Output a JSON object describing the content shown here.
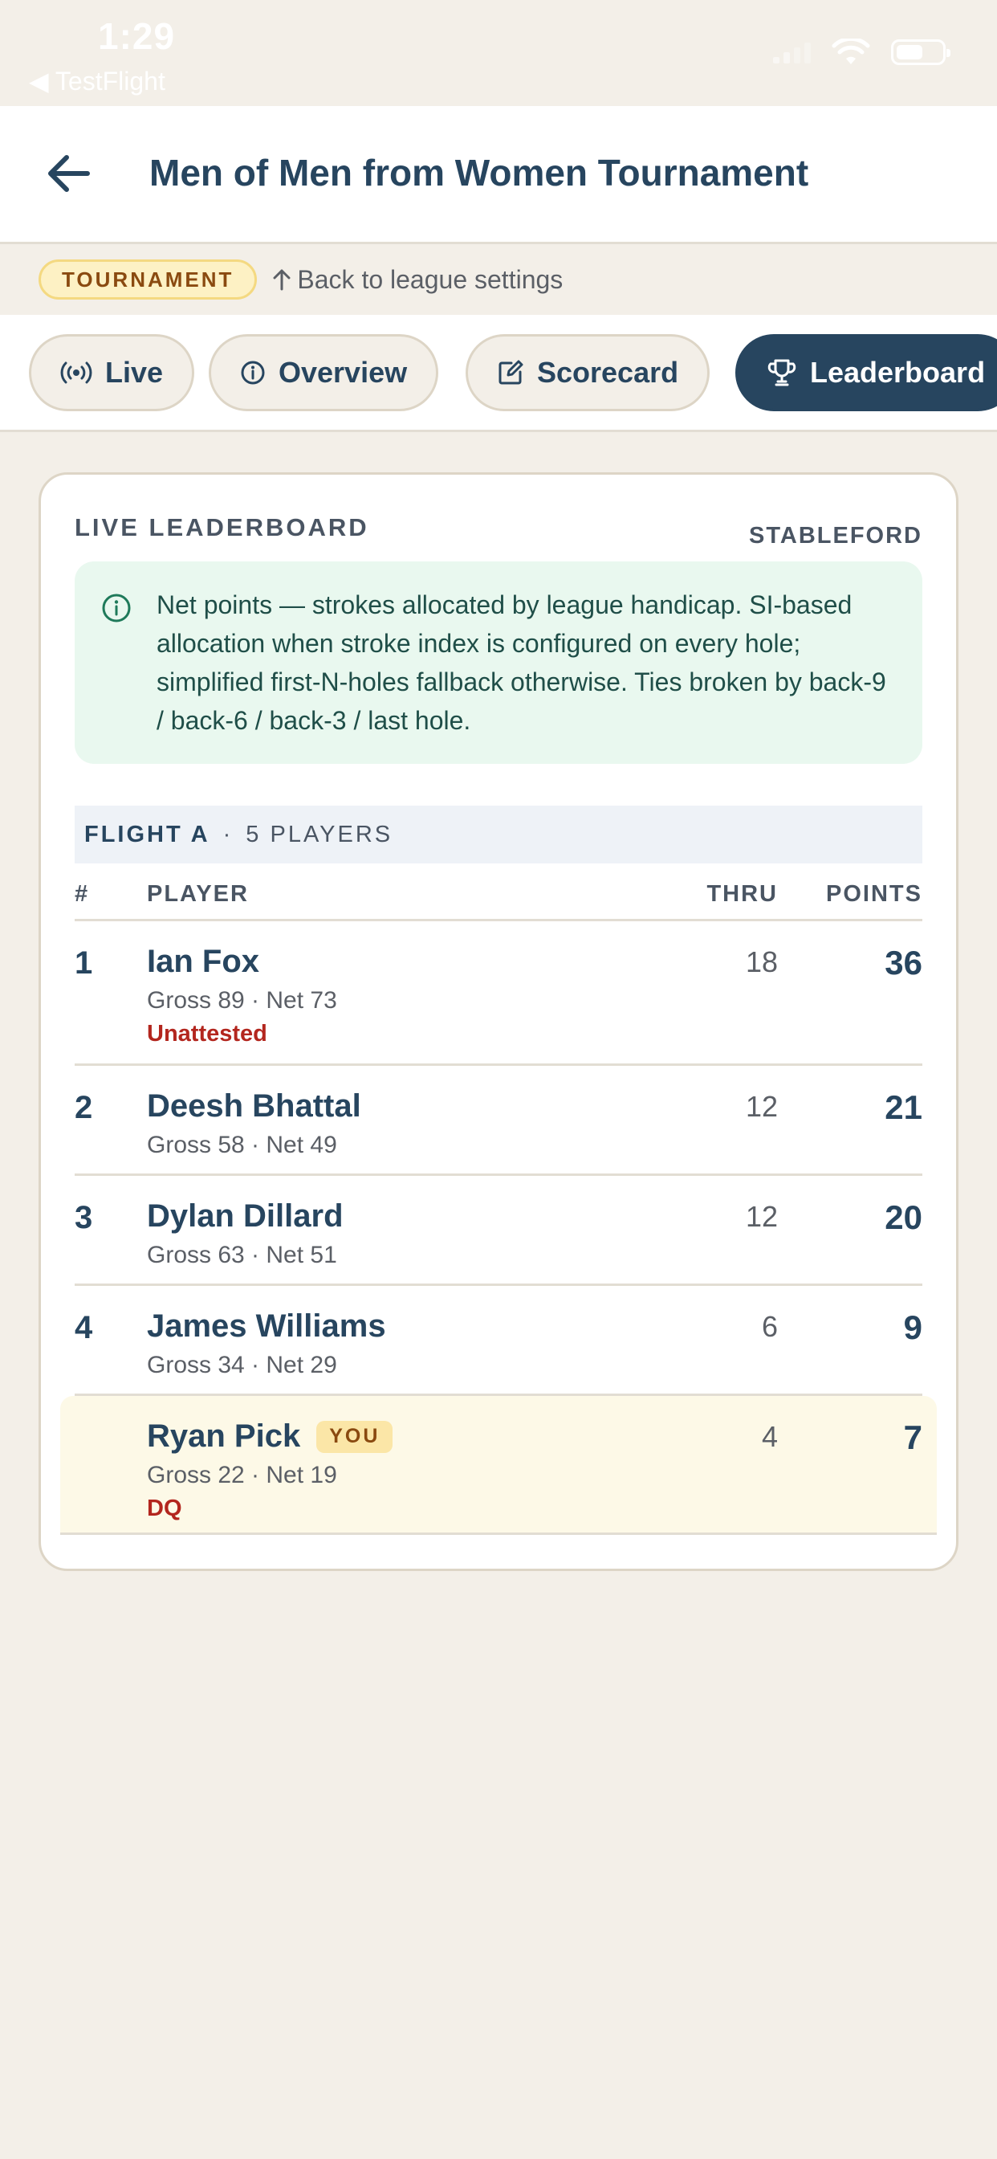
{
  "status_bar": {
    "time": "1:29",
    "back_app": "◀ TestFlight"
  },
  "header": {
    "title": "Men of Men from Women Tournament"
  },
  "subnav": {
    "badge": "TOURNAMENT",
    "back_link": "Back to league settings"
  },
  "tabs": [
    {
      "label": "Live",
      "icon": "broadcast-icon"
    },
    {
      "label": "Overview",
      "icon": "info-icon"
    },
    {
      "label": "Scorecard",
      "icon": "edit-icon"
    },
    {
      "label": "Leaderboard",
      "icon": "trophy-icon",
      "active": true
    }
  ],
  "leaderboard": {
    "title": "LIVE LEADERBOARD",
    "mode": "STABLEFORD",
    "info": "Net points — strokes allocated by league handicap. SI-based allocation when stroke index is configured on every hole; simplified first-N-holes fallback otherwise. Ties broken by back-9 / back-6 / back-3 / last hole.",
    "flight": {
      "name": "FLIGHT A",
      "separator": "·",
      "players": "5 PLAYERS"
    },
    "columns": {
      "rank": "#",
      "player": "PLAYER",
      "thru": "THRU",
      "points": "POINTS"
    },
    "rows": [
      {
        "rank": "1",
        "name": "Ian Fox",
        "detail": "Gross 89 · Net 73",
        "flag": "Unattested",
        "thru": "18",
        "points": "36"
      },
      {
        "rank": "2",
        "name": "Deesh Bhattal",
        "detail": "Gross 58 · Net 49",
        "flag": "",
        "thru": "12",
        "points": "21"
      },
      {
        "rank": "3",
        "name": "Dylan Dillard",
        "detail": "Gross 63 · Net 51",
        "flag": "",
        "thru": "12",
        "points": "20"
      },
      {
        "rank": "4",
        "name": "James Williams",
        "detail": "Gross 34 · Net 29",
        "flag": "",
        "thru": "6",
        "points": "9"
      },
      {
        "rank": "",
        "name": "Ryan Pick",
        "badge": "YOU",
        "detail": "Gross 22 · Net 19",
        "flag": "DQ",
        "thru": "4",
        "points": "7"
      }
    ]
  },
  "colors": {
    "navy": "#27455f",
    "background": "#f3efe8",
    "danger": "#b3261e",
    "info_bg": "#e9f8ef",
    "you_bg": "#fdf9e7"
  }
}
